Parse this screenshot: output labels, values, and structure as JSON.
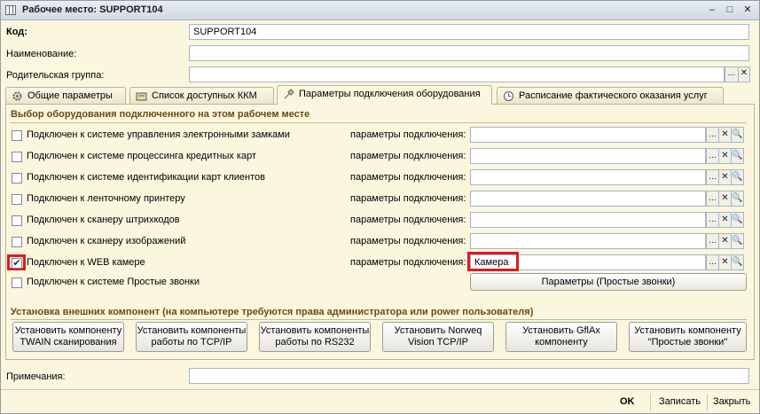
{
  "window": {
    "title": "Рабочее место: SUPPORT104",
    "minimize": "–",
    "restore": "□",
    "close": "✕"
  },
  "fields": {
    "code_label": "Код:",
    "code_value": "SUPPORT104",
    "name_label": "Наименование:",
    "name_value": "",
    "parent_label": "Родительская группа:",
    "parent_value": "",
    "parent_select": "...",
    "parent_clear": "✕"
  },
  "tabs": [
    {
      "label": "Общие параметры",
      "icon": "gear-icon"
    },
    {
      "label": "Список доступных ККМ",
      "icon": "register-icon"
    },
    {
      "label": "Параметры подключения оборудования",
      "icon": "connection-icon"
    },
    {
      "label": "Расписание фактического оказания услуг",
      "icon": "clock-icon"
    }
  ],
  "equipment": {
    "section_title": "Выбор оборудования подключенного на этом рабочем месте",
    "param_label": "параметры подключения:",
    "select_btn": "...",
    "clear_btn": "✕",
    "search_btn": "🔍",
    "rows": [
      {
        "label": "Подключен к системе управления электронными замками",
        "checked": false,
        "value": ""
      },
      {
        "label": "Подключен к системе процессинга кредитных карт",
        "checked": false,
        "value": ""
      },
      {
        "label": "Подключен к системе идентификации карт клиентов",
        "checked": false,
        "value": ""
      },
      {
        "label": "Подключен к ленточному принтеру",
        "checked": false,
        "value": ""
      },
      {
        "label": "Подключен к сканеру штрихкодов",
        "checked": false,
        "value": ""
      },
      {
        "label": "Подключен к сканеру изображений",
        "checked": false,
        "value": ""
      },
      {
        "label": "Подключен к WEB камере",
        "checked": true,
        "value": "Камера"
      }
    ],
    "simple_calls_label": "Подключен к системе Простые звонки",
    "simple_calls_checked": false,
    "simple_calls_button": "Параметры (Простые звонки)",
    "check_mark": "✔"
  },
  "components": {
    "section_title": "Установка внешних компонент (на компьютере требуются права администратора или power пользователя)",
    "buttons": [
      {
        "label": "Установить компоненту TWAIN сканирования"
      },
      {
        "label": "Установить компоненты работы по TCP/IP"
      },
      {
        "label": "Установить компоненты работы по RS232"
      },
      {
        "label": "Установить Norweq Vision TCP/IP компоненту"
      },
      {
        "label": "Установить GflAx компоненту"
      },
      {
        "label": "Установить компоненту \"Простые звонки\""
      }
    ]
  },
  "notes": {
    "label": "Примечания:",
    "value": ""
  },
  "footer": {
    "ok": "OK",
    "save": "Записать",
    "close": "Закрыть"
  },
  "colors": {
    "background": "#fbf6de",
    "section_title": "#6b4a13",
    "highlight": "#e0191f"
  }
}
